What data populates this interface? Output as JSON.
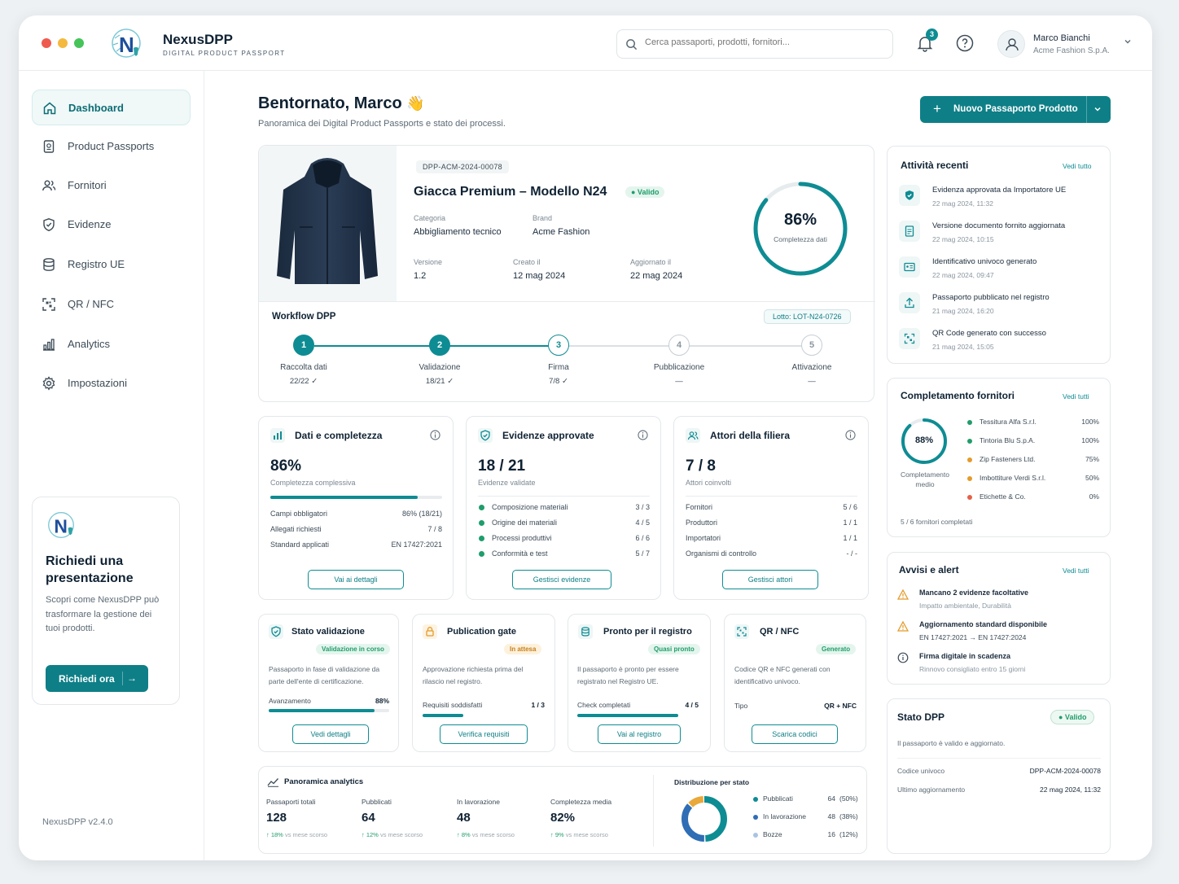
{
  "colors": {
    "accent": "#0e8c93",
    "accent_dark": "#0e7f87",
    "amber": "#e49b2a",
    "blue": "#2f6db5",
    "grey": "#9aa6ae",
    "red": "#e5604a"
  },
  "app": {
    "name": "NexusDPP",
    "subtitle": "DIGITAL PRODUCT PASSPORT",
    "version": "NexusDPP v2.4.0"
  },
  "search": {
    "placeholder": "Cerca passaporti, prodotti, fornitori..."
  },
  "notifications": {
    "count": "3"
  },
  "user": {
    "name": "Marco Bianchi",
    "company": "Acme Fashion S.p.A."
  },
  "sidebar": {
    "items": [
      {
        "label": "Dashboard",
        "icon": "home-icon",
        "active": true
      },
      {
        "label": "Product Passports",
        "icon": "passport-icon"
      },
      {
        "label": "Fornitori",
        "icon": "users-icon"
      },
      {
        "label": "Evidenze",
        "icon": "shield-icon"
      },
      {
        "label": "Registro UE",
        "icon": "database-icon"
      },
      {
        "label": "QR / NFC",
        "icon": "qr-icon"
      },
      {
        "label": "Analytics",
        "icon": "chart-icon"
      },
      {
        "label": "Impostazioni",
        "icon": "gear-icon"
      }
    ]
  },
  "promo": {
    "title": "Richiedi una presentazione",
    "text": "Scopri come NexusDPP può trasformare la gestione dei tuoi prodotti.",
    "button": "Richiedi ora"
  },
  "header": {
    "greeting": "Bentornato, Marco",
    "wave": "👋",
    "subtitle": "Panoramica dei Digital Product Passports e stato dei processi.",
    "new_button": "Nuovo Passaporto Prodotto"
  },
  "product": {
    "id": "DPP-ACM-2024-00078",
    "name": "Giacca Premium – Modello N24",
    "status": "● Valido",
    "category_label": "Categoria",
    "category": "Abbigliamento tecnico",
    "brand_label": "Brand",
    "brand": "Acme Fashion",
    "version_label": "Versione",
    "version": "1.2",
    "created_label": "Creato il",
    "created": "12 mag 2024",
    "updated_label": "Aggiornato il",
    "updated": "22 mag 2024",
    "completeness": "86%",
    "completeness_value": 0.86,
    "completeness_label": "Completezza dati"
  },
  "workflow": {
    "title": "Workflow DPP",
    "lot": "Lotto: LOT-N24-0726",
    "steps": [
      {
        "n": "1",
        "label": "Raccolta dati",
        "sub": "22/22 ✓",
        "state": "done"
      },
      {
        "n": "2",
        "label": "Validazione",
        "sub": "18/21 ✓",
        "state": "done"
      },
      {
        "n": "3",
        "label": "Firma",
        "sub": "7/8 ✓",
        "state": "current"
      },
      {
        "n": "4",
        "label": "Pubblicazione",
        "sub": "—",
        "state": "todo"
      },
      {
        "n": "5",
        "label": "Attivazione",
        "sub": "—",
        "state": "todo"
      }
    ]
  },
  "kpi": [
    {
      "title": "Dati e completezza",
      "value": "86%",
      "sub": "Completezza complessiva",
      "progress": 0.86,
      "rows": [
        [
          "Campi obbligatori",
          "86% (18/21)"
        ],
        [
          "Allegati richiesti",
          "7 / 8"
        ],
        [
          "Standard applicati",
          "EN 17427:2021"
        ]
      ],
      "button": "Vai ai dettagli"
    },
    {
      "title": "Evidenze approvate",
      "value": "18 / 21",
      "sub": "Evidenze validate",
      "rows": [
        [
          "Composizione materiali",
          "3 / 3"
        ],
        [
          "Origine dei materiali",
          "4 / 5"
        ],
        [
          "Processi produttivi",
          "6 / 6"
        ],
        [
          "Conformità e test",
          "5 / 7"
        ]
      ],
      "button": "Gestisci evidenze"
    },
    {
      "title": "Attori della filiera",
      "value": "7 / 8",
      "sub": "Attori coinvolti",
      "rows": [
        [
          "Fornitori",
          "5 / 6"
        ],
        [
          "Produttori",
          "1 / 1"
        ],
        [
          "Importatori",
          "1 / 1"
        ],
        [
          "Organismi di controllo",
          "- / -"
        ]
      ],
      "button": "Gestisci attori"
    }
  ],
  "status_cards": [
    {
      "title": "Stato validazione",
      "badge": "Validazione in corso",
      "text": "Passaporto in fase di validazione da parte dell'ente di certificazione.",
      "metric": "Avanzamento",
      "metric_value": "88%",
      "progress": 0.88,
      "button": "Vedi dettagli"
    },
    {
      "title": "Publication gate",
      "badge": "In attesa",
      "text": "Approvazione richiesta prima del rilascio nel registro.",
      "metric": "Requisiti soddisfatti",
      "metric_value": "1 / 3",
      "progress": 0.33,
      "button": "Verifica requisiti"
    },
    {
      "title": "Pronto per il registro",
      "badge": "Quasi pronto",
      "text": "Il passaporto è pronto per essere registrato nel Registro UE.",
      "metric": "Check completati",
      "metric_value": "4 / 5",
      "progress": 0.8,
      "button": "Vai al registro"
    },
    {
      "title": "QR / NFC",
      "badge": "Generato",
      "text": "Codice QR e NFC generati con identificativo univoco.",
      "metric": "Tipo",
      "metric_value": "QR + NFC",
      "button": "Scarica codici"
    }
  ],
  "analytics": {
    "title": "Panoramica analytics",
    "stats": [
      {
        "label": "Passaporti totali",
        "value": "128",
        "delta": "↑ 18%",
        "delta_text": "vs mese scorso"
      },
      {
        "label": "Pubblicati",
        "value": "64",
        "delta": "↑ 12%",
        "delta_text": "vs mese scorso"
      },
      {
        "label": "In lavorazione",
        "value": "48",
        "delta": "↑ 8%",
        "delta_text": "vs mese scorso"
      },
      {
        "label": "Completezza media",
        "value": "82%",
        "delta": "↑ 9%",
        "delta_text": "vs mese scorso"
      }
    ]
  },
  "chart_data": {
    "type": "pie",
    "title": "Distribuzione per stato",
    "donut": true,
    "categories": [
      "Pubblicati",
      "In lavorazione",
      "Bozze"
    ],
    "values": [
      64,
      48,
      16
    ],
    "percent_labels": [
      "(50%)",
      "(38%)",
      "(12%)"
    ],
    "colors": [
      "#0e8c93",
      "#2f6db5",
      "#e9a83a"
    ]
  },
  "activity": {
    "title": "Attività recenti",
    "link": "Vedi tutto",
    "items": [
      {
        "icon": "shield-check-icon",
        "text": "Evidenza approvata da Importatore UE",
        "date": "22 mag 2024, 11:32"
      },
      {
        "icon": "document-icon",
        "text": "Versione documento fornito aggiornata",
        "date": "22 mag 2024, 10:15"
      },
      {
        "icon": "id-card-icon",
        "text": "Identificativo univoco generato",
        "date": "22 mag 2024, 09:47"
      },
      {
        "icon": "upload-icon",
        "text": "Passaporto pubblicato nel registro",
        "date": "21 mag 2024, 16:20"
      },
      {
        "icon": "qr-icon",
        "text": "QR Code generato con successo",
        "date": "21 mag 2024, 15:05"
      }
    ]
  },
  "suppliers": {
    "title": "Completamento fornitori",
    "link": "Vedi tutti",
    "avg": "88%",
    "avg_value": 0.88,
    "avg_label": "Completamento medio",
    "footer": "5 / 6 fornitori completati",
    "items": [
      {
        "name": "Tessitura Alfa S.r.l.",
        "value": "100%",
        "color": "#1f9d6b"
      },
      {
        "name": "Tintoria Blu S.p.A.",
        "value": "100%",
        "color": "#1f9d6b"
      },
      {
        "name": "Zip Fasteners Ltd.",
        "value": "75%",
        "color": "#e49b2a"
      },
      {
        "name": "Imbottiture Verdi S.r.l.",
        "value": "50%",
        "color": "#e49b2a"
      },
      {
        "name": "Etichette & Co.",
        "value": "0%",
        "color": "#e5604a"
      }
    ]
  },
  "alerts": {
    "title": "Avvisi e alert",
    "link": "Vedi tutti",
    "items": [
      {
        "icon": "warning-icon",
        "title": "Mancano 2 evidenze facoltative",
        "text": "Impatto ambientale, Durabilità"
      },
      {
        "icon": "warning-icon",
        "title": "Aggiornamento standard disponibile",
        "text": "EN 17427:2021 → EN 17427:2024"
      },
      {
        "icon": "info-icon",
        "title": "Firma digitale in scadenza",
        "text": "Rinnovo consigliato entro 15 giorni"
      }
    ]
  },
  "dpp_status": {
    "title": "Stato DPP",
    "badge": "● Valido",
    "text": "Il passaporto è valido e aggiornato.",
    "code_label": "Codice univoco",
    "code": "DPP-ACM-2024-00078",
    "updated_label": "Ultimo aggiornamento",
    "updated": "22 mag 2024, 11:32"
  }
}
